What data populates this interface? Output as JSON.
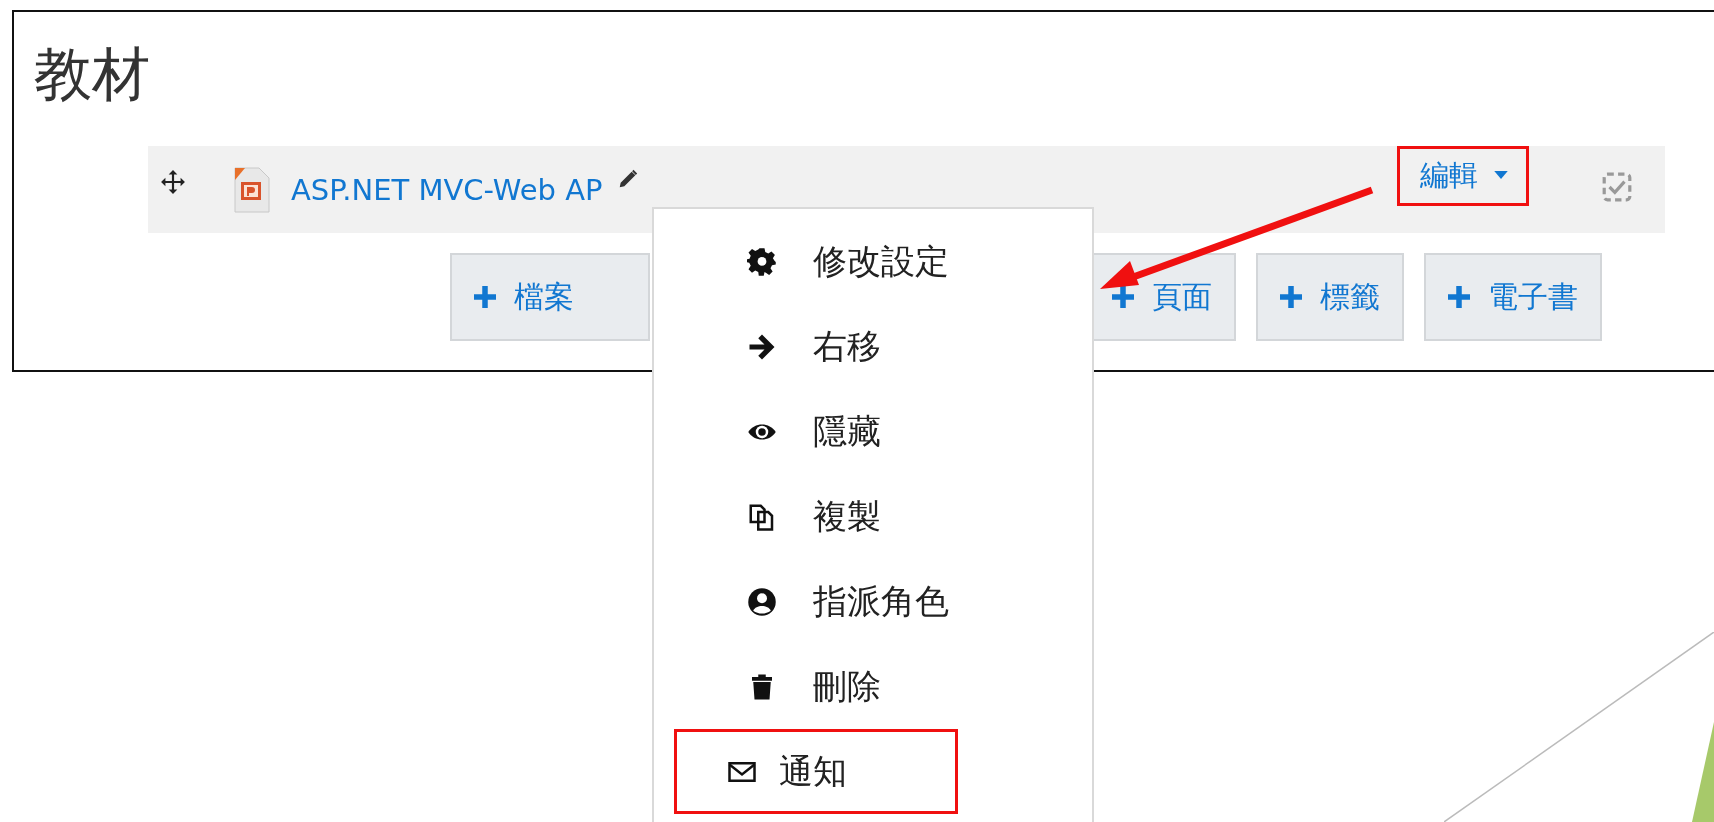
{
  "section": {
    "title": "教材"
  },
  "activity": {
    "name": "ASP.NET MVC-Web AP",
    "edit_menu": {
      "label": "編輯",
      "highlighted": true
    }
  },
  "add_buttons": [
    {
      "label": "檔案"
    },
    {
      "label": "頁面"
    },
    {
      "label": "標籤"
    },
    {
      "label": "電子書"
    }
  ],
  "menu": [
    {
      "label": "修改設定",
      "highlighted": false
    },
    {
      "label": "右移",
      "highlighted": false
    },
    {
      "label": "隱藏",
      "highlighted": false
    },
    {
      "label": "複製",
      "highlighted": false
    },
    {
      "label": "指派角色",
      "highlighted": false
    },
    {
      "label": "刪除",
      "highlighted": false
    },
    {
      "label": "通知",
      "highlighted": true
    }
  ]
}
